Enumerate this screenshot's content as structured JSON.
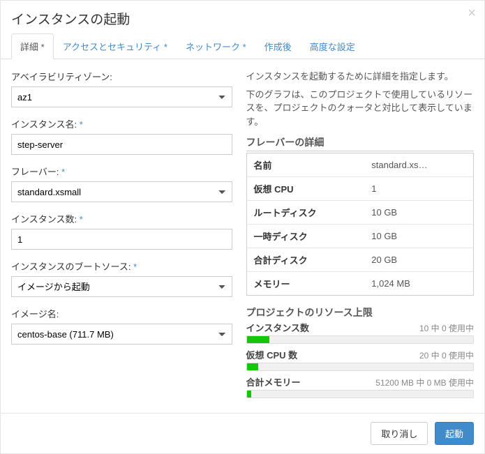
{
  "header": {
    "title": "インスタンスの起動"
  },
  "tabs": {
    "detail": "詳細",
    "access": "アクセスとセキュリティ",
    "network": "ネットワーク",
    "postcreate": "作成後",
    "advanced": "高度な設定"
  },
  "form": {
    "availability_zone": {
      "label": "アベイラビリティゾーン:",
      "value": "az1"
    },
    "instance_name": {
      "label": "インスタンス名:",
      "value": "step-server"
    },
    "flavor": {
      "label": "フレーバー:",
      "value": "standard.xsmall"
    },
    "instance_count": {
      "label": "インスタンス数:",
      "value": "1"
    },
    "boot_source": {
      "label": "インスタンスのブートソース:",
      "value": "イメージから起動"
    },
    "image_name": {
      "label": "イメージ名:",
      "value": "centos-base (711.7 MB)"
    }
  },
  "right": {
    "desc1": "インスタンスを起動するために詳細を指定します。",
    "desc2": "下のグラフは、このプロジェクトで使用しているリソースを、プロジェクトのクォータと対比して表示しています。",
    "flavor_details_title": "フレーバーの詳細",
    "details": {
      "name_key": "名前",
      "name_val": "standard.xs…",
      "vcpu_key": "仮想 CPU",
      "vcpu_val": "1",
      "rootdisk_key": "ルートディスク",
      "rootdisk_val": "10 GB",
      "tmpdisk_key": "一時ディスク",
      "tmpdisk_val": "10 GB",
      "totaldisk_key": "合計ディスク",
      "totaldisk_val": "20 GB",
      "memory_key": "メモリー",
      "memory_val": "1,024 MB"
    },
    "limits_title": "プロジェクトのリソース上限",
    "limits": {
      "instances": {
        "name": "インスタンス数",
        "stat": "10 中 0 使用中"
      },
      "vcpus": {
        "name": "仮想 CPU 数",
        "stat": "20 中 0 使用中"
      },
      "memory": {
        "name": "合計メモリー",
        "stat": "51200 MB 中 0 MB 使用中"
      }
    }
  },
  "footer": {
    "cancel": "取り消し",
    "launch": "起動"
  }
}
